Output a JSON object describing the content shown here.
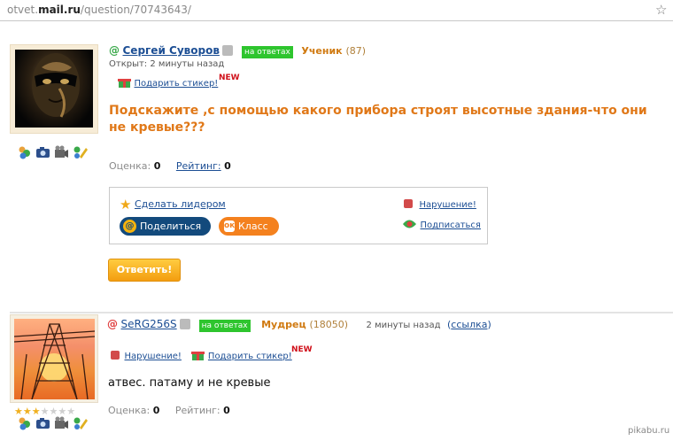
{
  "browser": {
    "url_prefix": "otvet.",
    "url_host": "mail.ru",
    "url_path": "/question/70743643/",
    "bookmark_icon": "star-icon"
  },
  "question": {
    "author": {
      "name": "Сергей Суворов",
      "status_badge": "на ответах",
      "rank": "Ученик",
      "score": "(87)"
    },
    "opened": "Открыт: 2 минуты назад",
    "gift_sticker": "Подарить стикер!",
    "new_badge": "NEW",
    "title": "Подскажите ,с помощью какого прибора строят высотные здания-что они не кревые???",
    "rating": {
      "score_label": "Оценка:",
      "score_value": "0",
      "rating_label": "Рейтинг:",
      "rating_value": "0"
    },
    "actions": {
      "make_leader": "Сделать лидером",
      "share": "Поделиться",
      "class": "Класс",
      "violation": "Нарушение!",
      "subscribe": "Подписаться"
    },
    "answer_button": "Ответить!"
  },
  "answer": {
    "author": {
      "name": "SeRG256S",
      "status_badge": "на ответах",
      "rank": "Мудрец",
      "score": "(18050)"
    },
    "time": "2 минуты назад",
    "link": "ссылка",
    "link_open": "(",
    "link_close": ")",
    "violation": "Нарушение!",
    "gift_sticker": "Подарить стикер!",
    "new_badge": "NEW",
    "text": "атвес. патаму и не кревые",
    "stars_filled": 3,
    "stars_total": 7,
    "rating": {
      "score_label": "Оценка:",
      "score_value": "0",
      "rating_label": "Рейтинг:",
      "rating_value": "0"
    }
  },
  "watermark": "pikabu.ru",
  "colors": {
    "link": "#1c4e94",
    "title_orange": "#e07818",
    "badge_green": "#2ec52e",
    "share_blue": "#134a7c",
    "class_orange": "#f4811e"
  }
}
